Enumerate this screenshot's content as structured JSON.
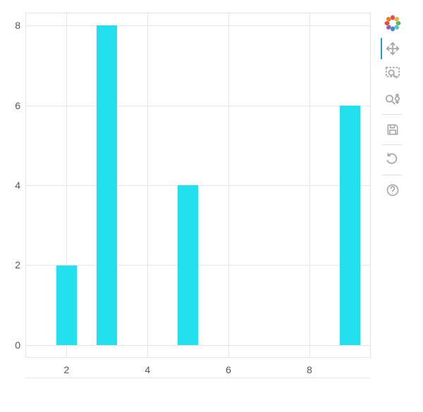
{
  "chart_data": {
    "type": "bar",
    "x": [
      2,
      3,
      5,
      9
    ],
    "values": [
      2,
      8,
      4,
      6
    ],
    "bar_width": 0.5,
    "xlim": [
      1.0,
      9.5
    ],
    "ylim": [
      -0.3,
      8.3
    ],
    "x_ticks": [
      2,
      4,
      6,
      8
    ],
    "y_ticks": [
      0,
      2,
      4,
      6,
      8
    ],
    "title": "",
    "xlabel": "",
    "ylabel": "",
    "bar_color": "#22e0ed",
    "grid": true
  },
  "toolbar": {
    "logo_name": "bokeh-logo-icon",
    "tools": [
      {
        "id": "pan",
        "name": "pan-tool-icon",
        "active": true
      },
      {
        "id": "box-zoom",
        "name": "box-zoom-tool-icon",
        "active": false
      },
      {
        "id": "wheel-zoom",
        "name": "wheel-zoom-tool-icon",
        "active": false
      },
      {
        "id": "save",
        "name": "save-tool-icon",
        "active": false
      },
      {
        "id": "reset",
        "name": "reset-tool-icon",
        "active": false
      },
      {
        "id": "help",
        "name": "help-tool-icon",
        "active": false
      }
    ]
  }
}
